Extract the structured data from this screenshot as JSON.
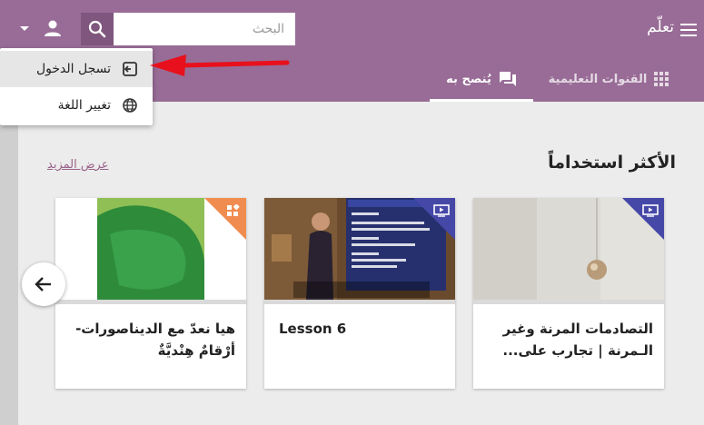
{
  "header": {
    "app_title": "تعلّم",
    "search_placeholder": "البحث",
    "menu_icon": "hamburger-icon",
    "search_icon": "search-icon",
    "user_icon": "account-icon"
  },
  "tabs": [
    {
      "label": "القنوات التعليمية",
      "icon": "apps-grid-icon"
    },
    {
      "label": "يُنصح به",
      "icon": "forum-icon",
      "selected": true
    }
  ],
  "user_menu": {
    "items": [
      {
        "label": "تسجل الدخول",
        "icon": "login-icon"
      },
      {
        "label": "تغيير اللغة",
        "icon": "globe-icon"
      }
    ]
  },
  "section": {
    "title": "الأكثر استخداماً",
    "view_more": "عرض المزيد"
  },
  "cards": [
    {
      "title": "التصادمات المرنة وغير الـمرنة | تجارب على...",
      "kind_icon": "video-icon",
      "progress": 0
    },
    {
      "title": "Lesson 6",
      "kind_icon": "video-icon",
      "progress": 0
    },
    {
      "title": "هيا نعدّ مع الديناصورات- أرْقامٌ هِنْديَّةٌ",
      "kind_icon": "app-icon",
      "progress": 0
    }
  ],
  "colors": {
    "appbar": "#986c96",
    "accent_link": "#996189",
    "video_corner": "#4648a8",
    "app_corner": "#f08c50",
    "annotation_arrow": "#e8101c"
  },
  "carousel": {
    "prev_icon": "arrow-left-icon"
  }
}
